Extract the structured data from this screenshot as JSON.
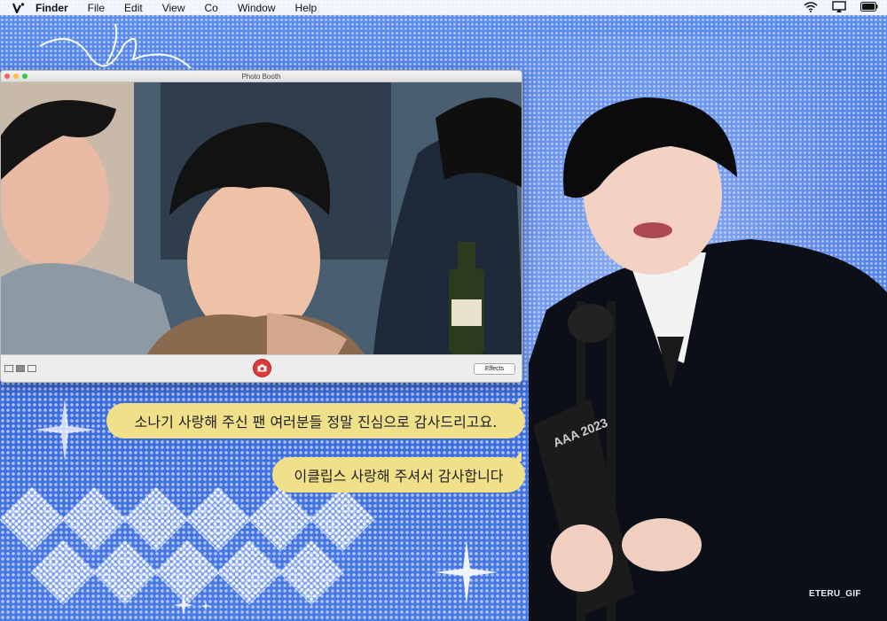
{
  "menubar": {
    "items": [
      {
        "label": "Finder"
      },
      {
        "label": "File"
      },
      {
        "label": "Edit"
      },
      {
        "label": "View"
      },
      {
        "label": "Co"
      },
      {
        "label": "Window"
      },
      {
        "label": "Help"
      }
    ],
    "status_icons": [
      "wifi-icon",
      "airplay-icon",
      "battery-icon"
    ]
  },
  "photo_booth": {
    "title": "Photo Booth",
    "effects_label": "Effects"
  },
  "speech": {
    "line1": "소나기 사랑해 주신 팬 여러분들 정말 진심으로 감사드리고요.",
    "line2": "이클립스 사랑해 주셔서 감사합니다"
  },
  "trophy_text": "AAA 2023",
  "watermark": "ETERU_GIF",
  "colors": {
    "bubble": "#f1e08a",
    "background_blue": "#4f7fe0",
    "shutter_red": "#d93a3a"
  }
}
